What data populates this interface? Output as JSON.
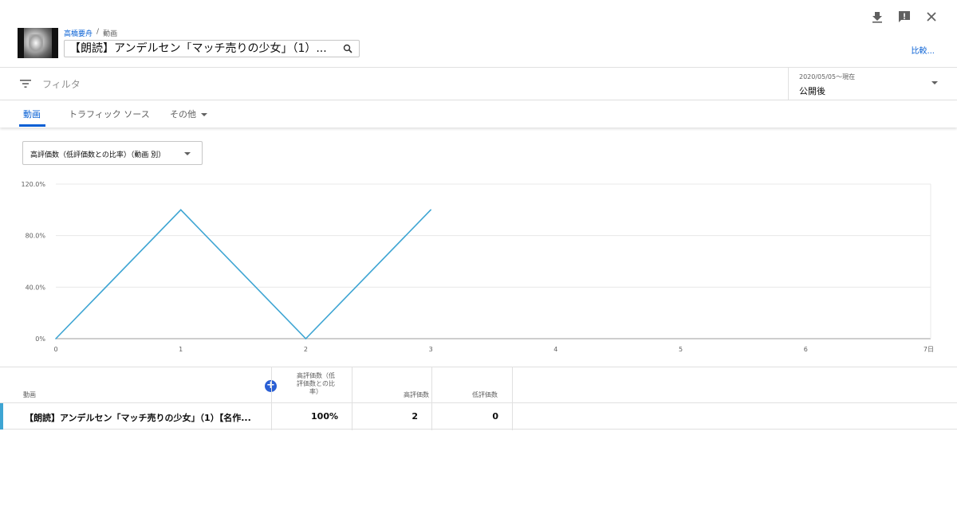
{
  "header": {
    "breadcrumb_channel": "高橋要舟",
    "breadcrumb_separator": "/",
    "breadcrumb_section": "動画",
    "video_title": "【朗読】アンデルセン「マッチ売りの少女」（1）...",
    "compare_label": "比較..."
  },
  "filter": {
    "placeholder": "フィルタ",
    "date_range": "2020/05/05～現在",
    "date_value": "公開後"
  },
  "tabs": [
    {
      "label": "動画",
      "active": true
    },
    {
      "label": "トラフィック ソース",
      "active": false
    },
    {
      "label": "その他",
      "active": false
    }
  ],
  "metric_selector": "高評価数（低評価数との比率）（動画 別）",
  "chart_data": {
    "type": "line",
    "x": [
      0,
      1,
      2,
      3
    ],
    "series": [
      {
        "values": [
          0,
          100,
          0,
          100
        ],
        "color": "#3ea5d3"
      }
    ],
    "xlim": [
      0,
      7
    ],
    "ylim": [
      0,
      120
    ],
    "x_ticks": [
      "0",
      "1",
      "2",
      "3",
      "4",
      "5",
      "6",
      "7日"
    ],
    "y_ticks": [
      "0%",
      "40.0%",
      "80.0%",
      "120.0%"
    ],
    "grid": true
  },
  "table": {
    "headers": {
      "video": "動画",
      "ratio_line1": "高評価数（低",
      "ratio_line2": "評価数との比",
      "ratio_line3": "率）",
      "likes": "高評価数",
      "dislikes": "低評価数"
    },
    "rows": [
      {
        "title": "【朗読】アンデルセン「マッチ売りの少女」（1）【名作...",
        "ratio": "100%",
        "likes": "2",
        "dislikes": "0"
      }
    ]
  }
}
